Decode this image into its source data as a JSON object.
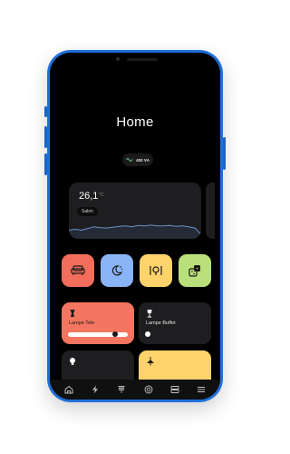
{
  "screen": {
    "title": "Home"
  },
  "power": {
    "value": "400 VA",
    "icon": "sine-wave-icon"
  },
  "temperature": {
    "value": "26,1",
    "unit": "°C",
    "room": "Salon",
    "history": [
      50,
      52,
      50,
      54,
      58,
      56,
      55,
      57,
      59,
      60,
      58,
      61,
      60,
      62,
      60,
      60,
      61,
      59,
      60,
      58,
      55,
      40
    ]
  },
  "quick_actions": [
    {
      "name": "sofa-scene",
      "icon": "sofa-icon",
      "color": "#f26d5b"
    },
    {
      "name": "night-scene",
      "icon": "moon-stars-icon",
      "color": "#8ab4f8"
    },
    {
      "name": "light-scene",
      "icon": "bulb-scene-icon",
      "color": "#ffd36b"
    },
    {
      "name": "random-scene",
      "icon": "dice-icon",
      "color": "#b9e07a"
    }
  ],
  "lights": [
    {
      "label": "Lampe Tele",
      "icon": "table-lamp-icon",
      "state": "on",
      "level": 0.82
    },
    {
      "label": "Lampe Buffet",
      "icon": "floor-lamp-icon",
      "state": "off",
      "level": 0.0
    }
  ],
  "lights_row2": [
    {
      "icon": "bulb-icon",
      "state": "off"
    },
    {
      "icon": "ceiling-lamp-icon",
      "state": "on"
    }
  ],
  "colors": {
    "accent_on": "#f47560",
    "accent_yellow": "#ffd36b",
    "card": "#1e1e20",
    "phone_frame": "#1f6fd9"
  },
  "nav": [
    {
      "icon": "house-icon"
    },
    {
      "icon": "lightning-icon"
    },
    {
      "icon": "blinds-icon"
    },
    {
      "icon": "target-icon"
    },
    {
      "icon": "storage-icon"
    },
    {
      "icon": "menu-icon"
    }
  ]
}
